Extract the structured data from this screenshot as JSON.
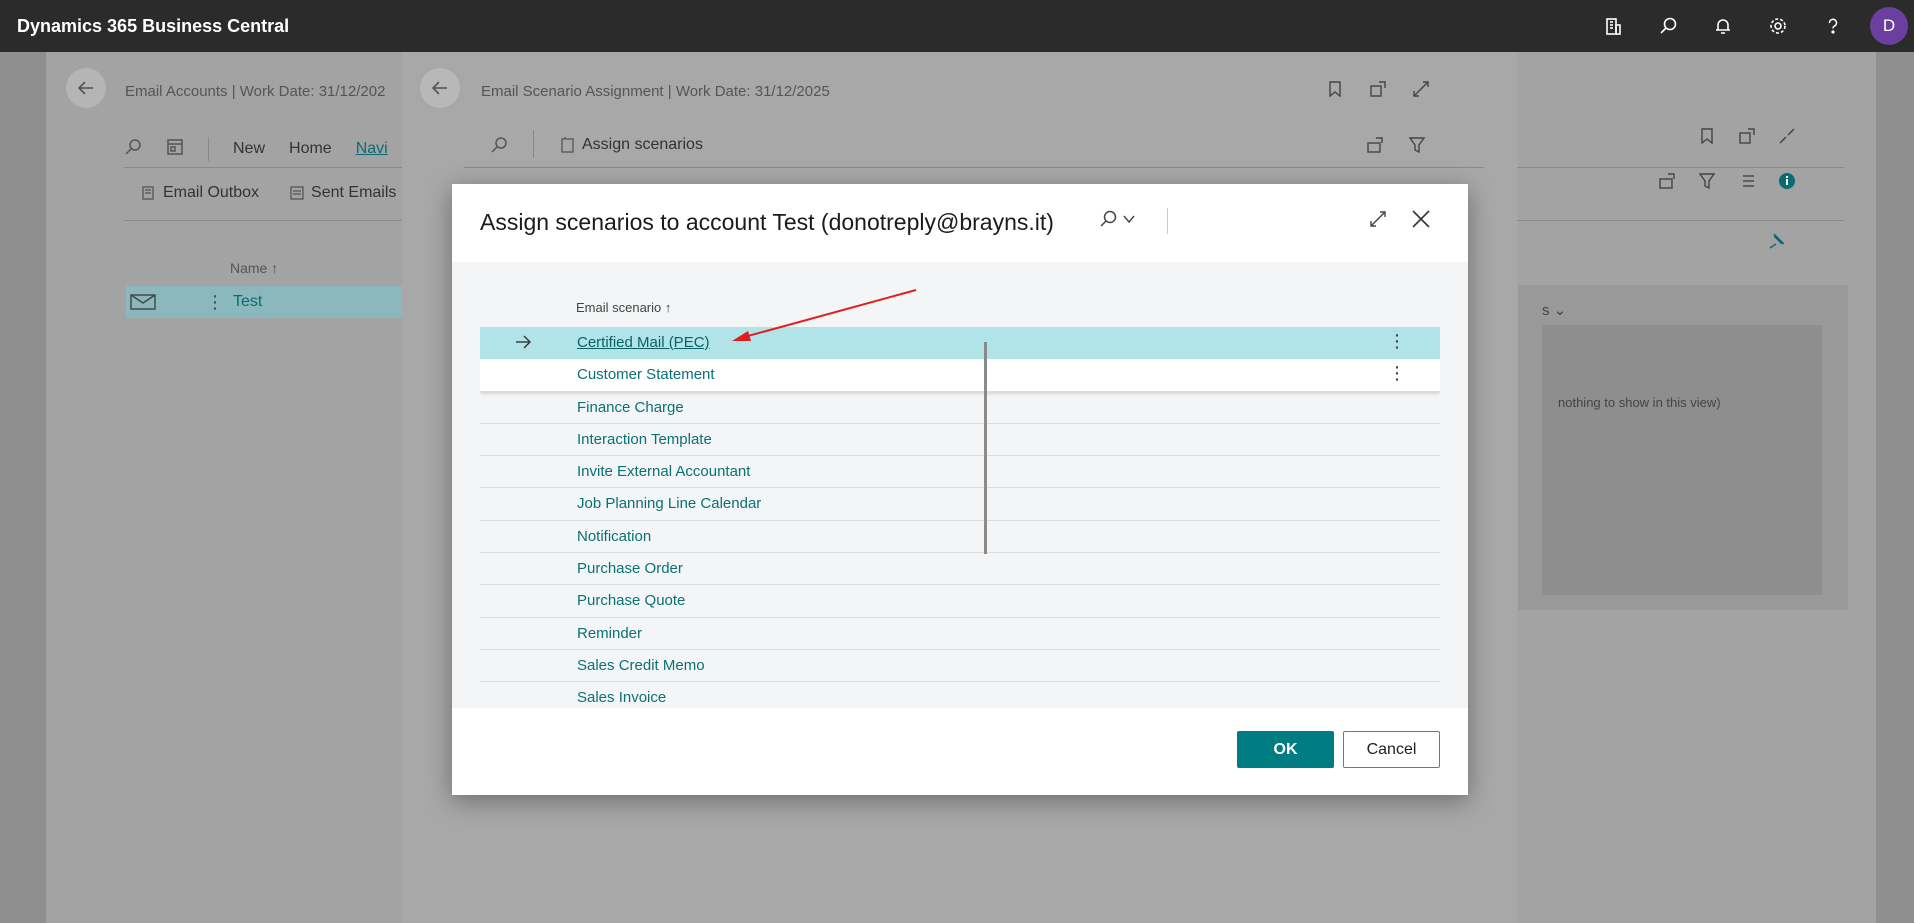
{
  "app": {
    "title": "Dynamics 365 Business Central",
    "user_initial": "D",
    "avatar_color": "#6b3fa0"
  },
  "topbar_icons": [
    "company-icon",
    "search-icon",
    "bell-icon",
    "gear-icon",
    "help-icon"
  ],
  "page_accounts": {
    "title": "Email Accounts | Work Date: 31/12/202",
    "toolbar": {
      "new": "New",
      "home": "Home",
      "navigate": "Navi"
    },
    "actions": {
      "outbox": "Email Outbox",
      "sent": "Sent Emails"
    },
    "column_name": "Name ↑",
    "row_name": "Test",
    "factbox_header": "s",
    "factbox_message": "nothing to show in this view)"
  },
  "page_scenarios": {
    "title": "Email Scenario Assignment | Work Date: 31/12/2025",
    "assign_label": "Assign scenarios"
  },
  "dialog": {
    "title": "Assign scenarios to account Test (donotreply@brayns.it)",
    "column_header": "Email scenario ↑",
    "rows": [
      "Certified Mail (PEC)",
      "Customer Statement",
      "Finance Charge",
      "Interaction Template",
      "Invite External Accountant",
      "Job Planning Line Calendar",
      "Notification",
      "Purchase Order",
      "Purchase Quote",
      "Reminder",
      "Sales Credit Memo",
      "Sales Invoice"
    ],
    "ok_label": "OK",
    "cancel_label": "Cancel",
    "accent": "#007d82",
    "selected_color": "#b1e4e8"
  }
}
